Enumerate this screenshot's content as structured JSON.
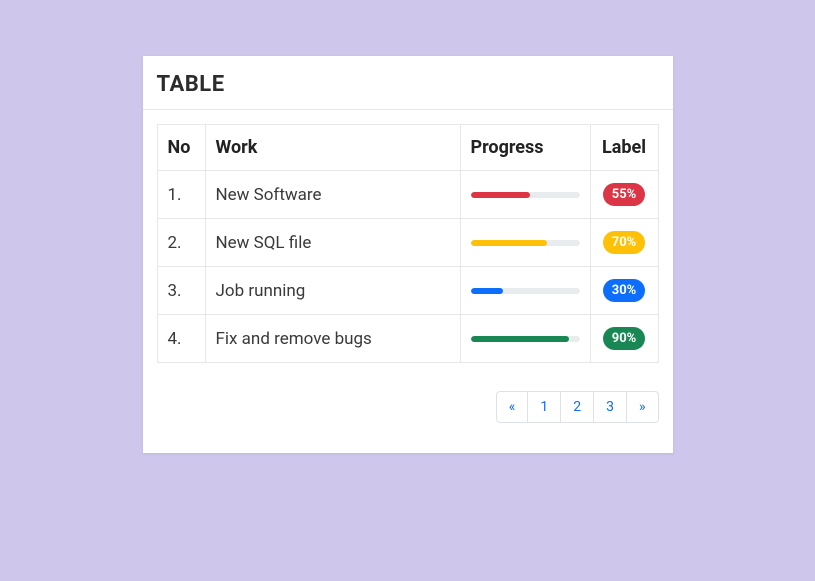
{
  "title": "TABLE",
  "columns": {
    "no": "No",
    "work": "Work",
    "progress": "Progress",
    "label": "Label"
  },
  "rows": [
    {
      "no": "1.",
      "work": "New Software",
      "progress": 55,
      "label": "55%",
      "color": "danger"
    },
    {
      "no": "2.",
      "work": "New SQL file",
      "progress": 70,
      "label": "70%",
      "color": "warning"
    },
    {
      "no": "3.",
      "work": "Job running",
      "progress": 30,
      "label": "30%",
      "color": "primary"
    },
    {
      "no": "4.",
      "work": "Fix and remove bugs",
      "progress": 90,
      "label": "90%",
      "color": "success"
    }
  ],
  "pagination": {
    "prev": "«",
    "pages": [
      "1",
      "2",
      "3"
    ],
    "next": "»"
  },
  "colors": {
    "danger": "#dc3545",
    "warning": "#ffc107",
    "primary": "#0d6efd",
    "success": "#198754"
  }
}
